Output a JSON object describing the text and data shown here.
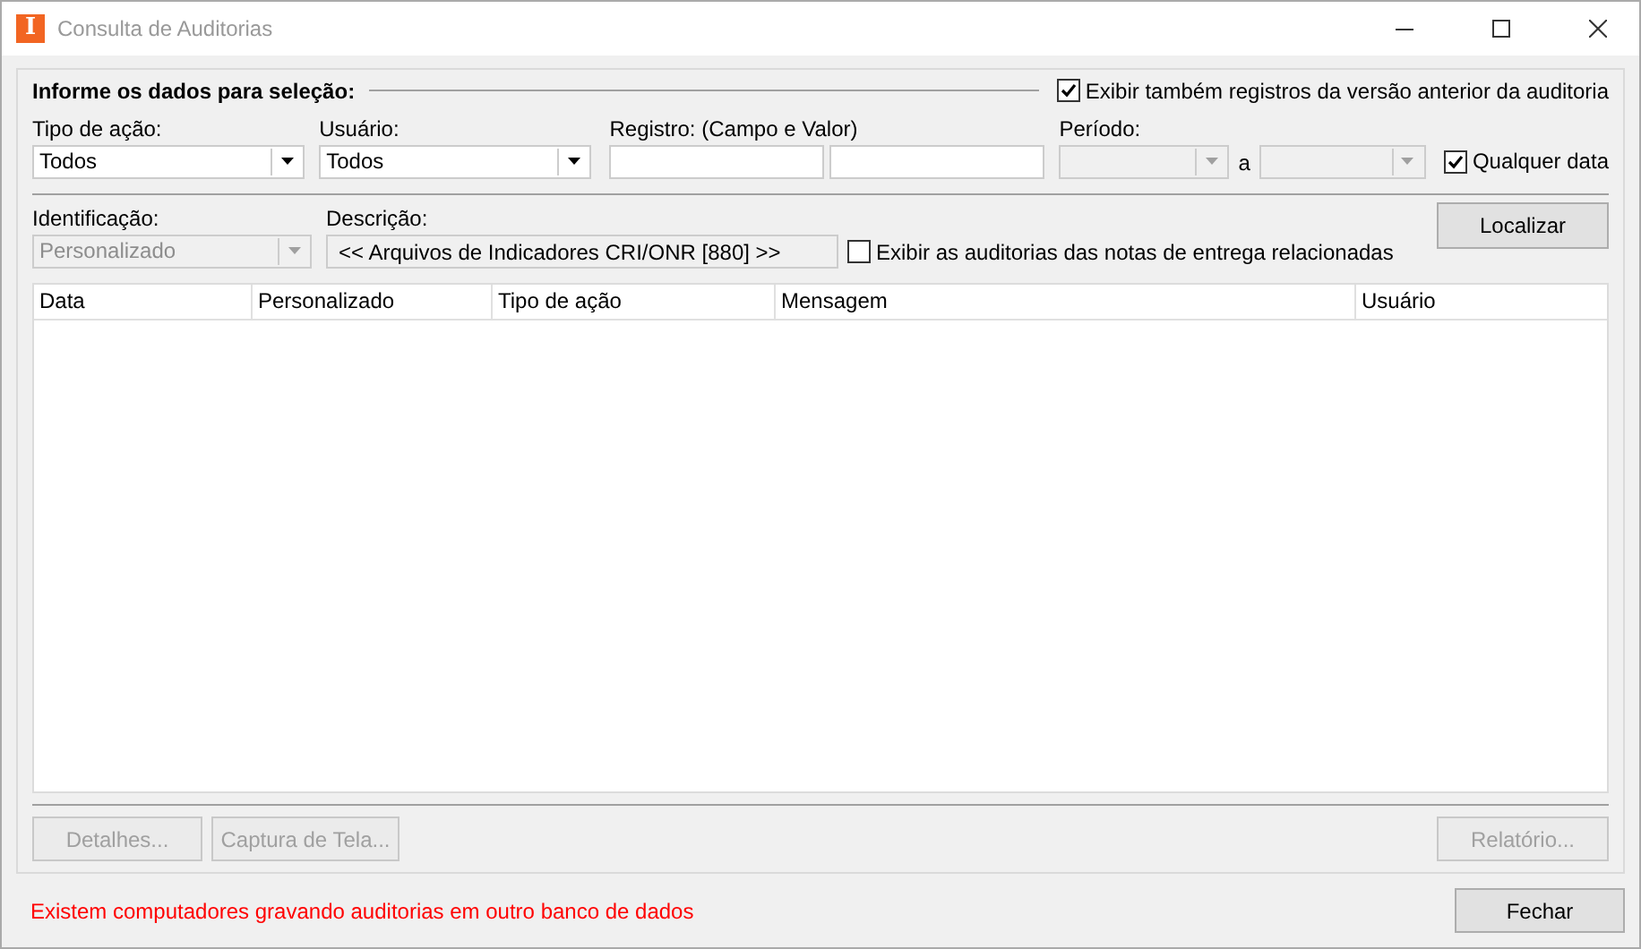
{
  "window": {
    "logo_letter": "I",
    "title": "Consulta de Auditorias"
  },
  "selection": {
    "heading": "Informe os dados para seleção:",
    "show_previous_version": {
      "label": "Exibir também registros da versão anterior da auditoria",
      "checked": true
    },
    "action_type": {
      "label": "Tipo de ação:",
      "value": "Todos",
      "disabled": false
    },
    "user": {
      "label": "Usuário:",
      "value": "Todos",
      "disabled": false
    },
    "record": {
      "label": "Registro: (Campo e Valor)"
    },
    "period": {
      "label": "Período:",
      "separator": "a",
      "disabled": true
    },
    "any_date": {
      "label": "Qualquer data",
      "checked": true
    },
    "identification": {
      "label": "Identificação:",
      "value": "Personalizado",
      "disabled": true
    },
    "description": {
      "label": "Descrição:",
      "value": "<< Arquivos de Indicadores CRI/ONR [880] >>"
    },
    "show_delivery_notes": {
      "label": "Exibir as auditorias das notas de entrega relacionadas",
      "checked": false
    },
    "search_button": {
      "label": "Localizar",
      "disabled": false
    },
    "table": {
      "columns": [
        "Data",
        "Personalizado",
        "Tipo de ação",
        "Mensagem",
        "Usuário"
      ]
    },
    "buttons": [
      {
        "label": "Detalhes...",
        "disabled": true
      },
      {
        "label": "Captura de Tela...",
        "disabled": true
      },
      {
        "label": "Relatório...",
        "disabled": true
      }
    ]
  },
  "status_message": "Existem computadores gravando auditorias em outro banco de dados",
  "close_button": {
    "label": "Fechar",
    "disabled": false
  }
}
